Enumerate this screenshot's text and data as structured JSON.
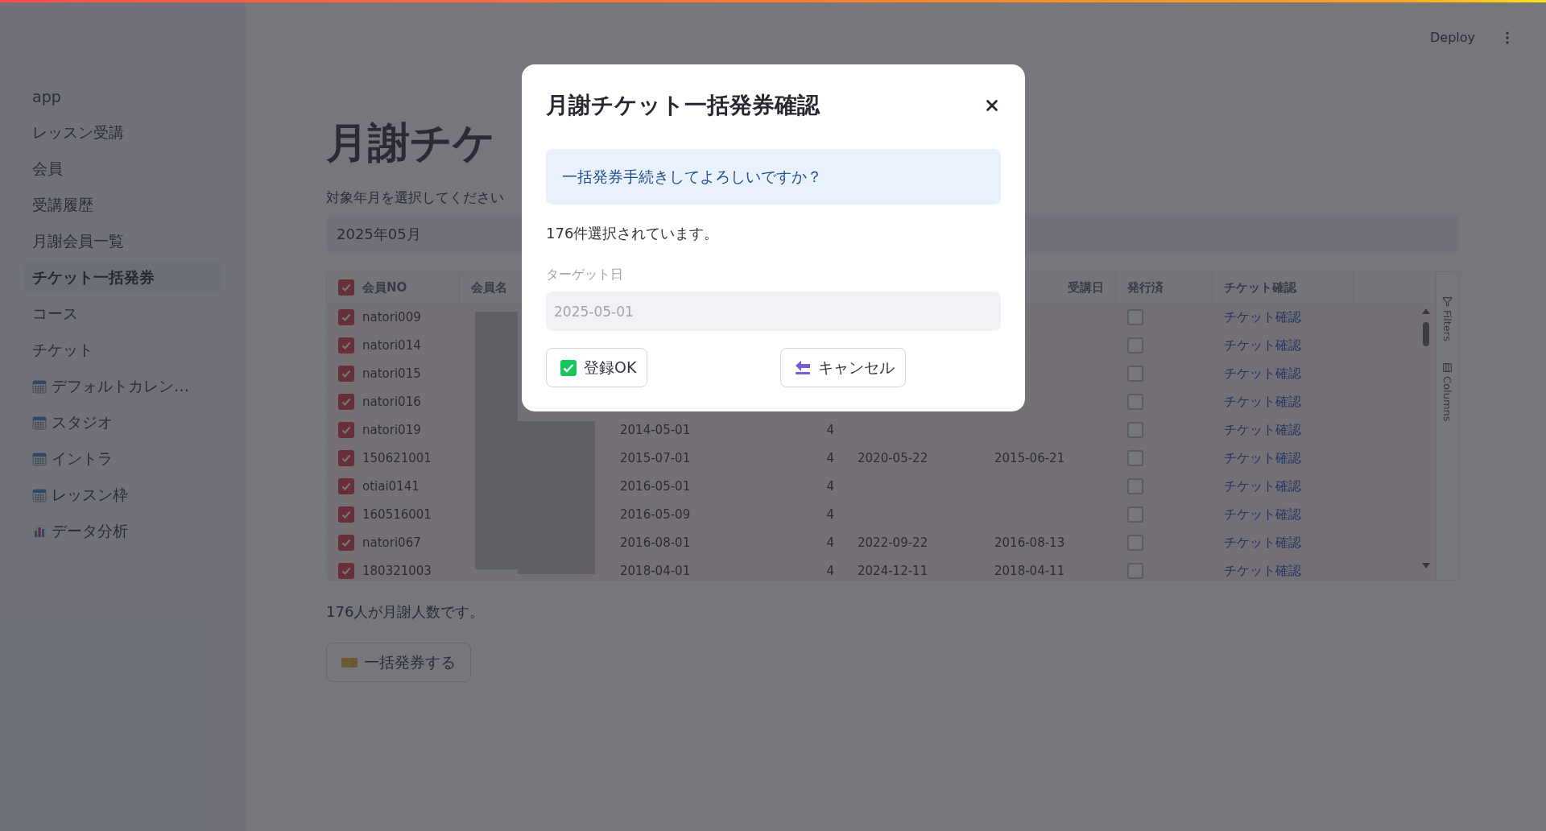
{
  "header": {
    "deploy": "Deploy"
  },
  "sidebar": {
    "items": [
      {
        "label": "app",
        "selected": false
      },
      {
        "label": "レッスン受講",
        "selected": false
      },
      {
        "label": "会員",
        "selected": false
      },
      {
        "label": "受講履歴",
        "selected": false
      },
      {
        "label": "月謝会員一覧",
        "selected": false
      },
      {
        "label": "チケット一括発券",
        "selected": true
      },
      {
        "label": "コース",
        "selected": false
      },
      {
        "label": "チケット",
        "selected": false
      },
      {
        "label": "デフォルトカレン…",
        "selected": false,
        "kind": "calendar"
      },
      {
        "label": "スタジオ",
        "selected": false,
        "kind": "calendar"
      },
      {
        "label": "イントラ",
        "selected": false,
        "kind": "calendar"
      },
      {
        "label": "レッスン枠",
        "selected": false,
        "kind": "calendar"
      },
      {
        "label": "データ分析",
        "selected": false,
        "kind": "chart"
      }
    ]
  },
  "page": {
    "title": "月謝チケ",
    "month_label": "対象年月を選択してください",
    "month_value": "2025年05月",
    "summary": "176人が月謝人数です。",
    "issue_button": "一括発券する"
  },
  "table": {
    "all_checked": true,
    "columns": {
      "member_no": "会員NO",
      "name": "会員名",
      "column_6": "受講日",
      "issued": "発行済",
      "link": "チケット確認"
    },
    "rows": [
      {
        "checked": true,
        "member_no": "natori009",
        "issued": false,
        "link": "チケット確認"
      },
      {
        "checked": true,
        "member_no": "natori014",
        "issued": false,
        "link": "チケット確認"
      },
      {
        "checked": true,
        "member_no": "natori015",
        "issued": false,
        "link": "チケット確認"
      },
      {
        "checked": true,
        "member_no": "natori016",
        "issued": false,
        "link": "チケット確認"
      },
      {
        "checked": true,
        "member_no": "natori019",
        "column_3": "2014-05-01",
        "column_4": "4",
        "issued": false,
        "link": "チケット確認"
      },
      {
        "checked": true,
        "member_no": "150621001",
        "column_3": "2015-07-01",
        "column_4": "4",
        "column_5": "2020-05-22",
        "column_6": "2015-06-21",
        "issued": false,
        "link": "チケット確認"
      },
      {
        "checked": true,
        "member_no": "otiai0141",
        "column_3": "2016-05-01",
        "column_4": "4",
        "issued": false,
        "link": "チケット確認"
      },
      {
        "checked": true,
        "member_no": "160516001",
        "column_3": "2016-05-09",
        "column_4": "4",
        "issued": false,
        "link": "チケット確認"
      },
      {
        "checked": true,
        "member_no": "natori067",
        "column_3": "2016-08-01",
        "column_4": "4",
        "column_5": "2022-09-22",
        "column_6": "2016-08-13",
        "issued": false,
        "link": "チケット確認"
      },
      {
        "checked": true,
        "member_no": "180321003",
        "column_3": "2018-04-01",
        "column_4": "4",
        "column_5": "2024-12-11",
        "column_6": "2018-04-11",
        "issued": false,
        "link": "チケット確認"
      }
    ],
    "toolbar": [
      "Filters",
      "Columns"
    ]
  },
  "dialog": {
    "title": "月謝チケット一括発券確認",
    "info": "一括発券手続きしてよろしいですか？",
    "count_text": "176件選択されています。",
    "date_label": "ターゲット日",
    "date_value": "2025-05-01",
    "date_disabled": true,
    "ok_button": "登録OK",
    "cancel_button": "キャンセル"
  }
}
